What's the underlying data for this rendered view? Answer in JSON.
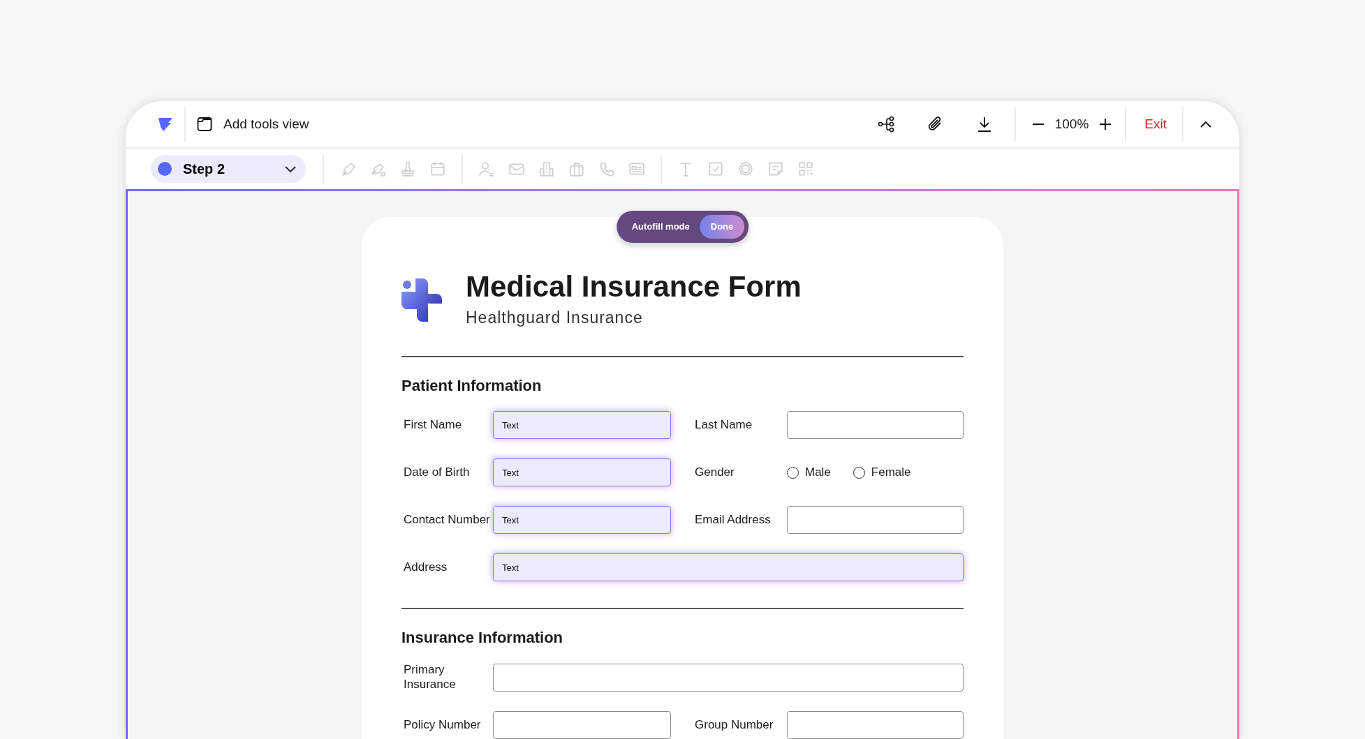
{
  "app_bar": {
    "title": "Add tools view",
    "zoom": "100%",
    "exit": "Exit"
  },
  "step": {
    "label": "Step 2"
  },
  "autofill": {
    "label": "Autofill mode",
    "button": "Done"
  },
  "form": {
    "title": "Medical Insurance Form",
    "subtitle": "Healthguard Insurance",
    "sections": [
      {
        "heading": "Patient Information",
        "fields": [
          {
            "kind": "text",
            "label": "First Name",
            "value": "Text",
            "highlighted": true,
            "wide": false
          },
          {
            "kind": "text",
            "label": "Last Name",
            "highlighted": false,
            "wide": false
          },
          {
            "kind": "text",
            "label": "Date of Birth",
            "value": "Text",
            "highlighted": true,
            "wide": false
          },
          {
            "kind": "radio",
            "label": "Gender",
            "options": [
              {
                "label": "Male",
                "checked": false
              },
              {
                "label": "Female",
                "checked": false
              }
            ]
          },
          {
            "kind": "text",
            "label": "Contact Number",
            "value": "Text",
            "highlighted": true,
            "wide": false
          },
          {
            "kind": "text",
            "label": "Email Address",
            "highlighted": false,
            "wide": false
          },
          {
            "kind": "text",
            "label": "Address",
            "value": "Text",
            "highlighted": true,
            "wide": true
          }
        ]
      },
      {
        "heading": "Insurance Information",
        "fields": [
          {
            "kind": "text",
            "label": "Primary Insurance",
            "highlighted": false,
            "wide": true
          },
          {
            "kind": "text",
            "label": "Policy Number",
            "highlighted": false,
            "wide": false
          },
          {
            "kind": "text",
            "label": "Group Number",
            "highlighted": false,
            "wide": false
          }
        ]
      }
    ]
  }
}
